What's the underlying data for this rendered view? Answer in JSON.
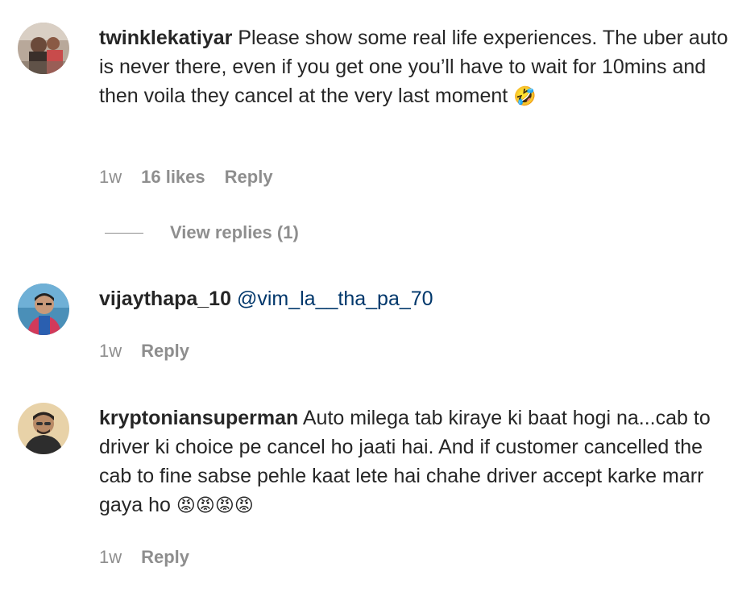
{
  "comments": [
    {
      "username": "twinklekatiyar",
      "text": "Please show some real life experiences. The uber auto is never there, even if you get one you’ll have to wait for 10mins and then voila they cancel at the very last moment",
      "emoji": "🤣",
      "time": "1w",
      "likes": "16 likes",
      "reply": "Reply",
      "view_replies": "View replies (1)",
      "avatar_icon": "user-avatar-icon"
    },
    {
      "username": "vijaythapa_10",
      "mention": "@vim_la__tha_pa_70",
      "time": "1w",
      "reply": "Reply",
      "avatar_icon": "user-avatar-icon"
    },
    {
      "username": "kryptoniansuperman",
      "text": "Auto milega tab kiraye ki baat hogi na...cab to driver ki choice pe cancel ho jaati hai. And if customer cancelled the cab to fine sabse pehle kaat lete hai chahe driver accept karke marr gaya ho",
      "emoji": "😡😡😡😡",
      "time": "1w",
      "reply": "Reply",
      "avatar_icon": "user-avatar-icon"
    }
  ],
  "colors": {
    "text": "#262626",
    "secondary": "#8e8e8e",
    "mention": "#00376b"
  }
}
